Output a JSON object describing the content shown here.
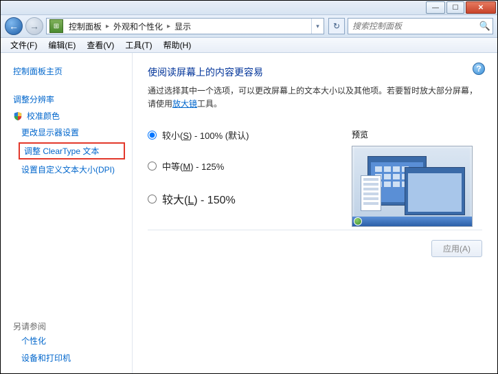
{
  "titlebar": {
    "min_glyph": "—",
    "max_glyph": "☐",
    "close_glyph": "✕"
  },
  "nav": {
    "back_glyph": "←",
    "fwd_glyph": "→",
    "refresh_glyph": "↻",
    "dropdown_glyph": "▾",
    "crumb_sep": "▸",
    "crumbs": [
      "控制面板",
      "外观和个性化",
      "显示"
    ]
  },
  "search": {
    "placeholder": "搜索控制面板",
    "icon": "🔍"
  },
  "menu": {
    "items": [
      "文件(F)",
      "编辑(E)",
      "查看(V)",
      "工具(T)",
      "帮助(H)"
    ]
  },
  "sidebar": {
    "home": "控制面板主页",
    "adjust_resolution": "调整分辨率",
    "calibrate_color": "校准颜色",
    "change_display": "更改显示器设置",
    "cleartype": "调整 ClearType 文本",
    "custom_dpi": "设置自定义文本大小(DPI)",
    "see_also": "另请参阅",
    "personalization": "个性化",
    "devices_printers": "设备和打印机"
  },
  "content": {
    "heading": "使阅读屏幕上的内容更容易",
    "desc_prefix": "通过选择其中一个选项，可以更改屏幕上的文本大小以及其他项。若要暂时放大部分屏幕，请使用",
    "desc_link": "放大镜",
    "desc_suffix": "工具。",
    "opt_small_prefix": "较小(",
    "opt_small_key": "S",
    "opt_small_suffix": ") - 100% (默认)",
    "opt_medium_prefix": "中等(",
    "opt_medium_key": "M",
    "opt_medium_suffix": ") - 125%",
    "opt_large_prefix": "较大(",
    "opt_large_key": "L",
    "opt_large_suffix": ") - 150%",
    "preview_label": "预览",
    "apply_label": "应用(A)",
    "help_glyph": "?"
  }
}
